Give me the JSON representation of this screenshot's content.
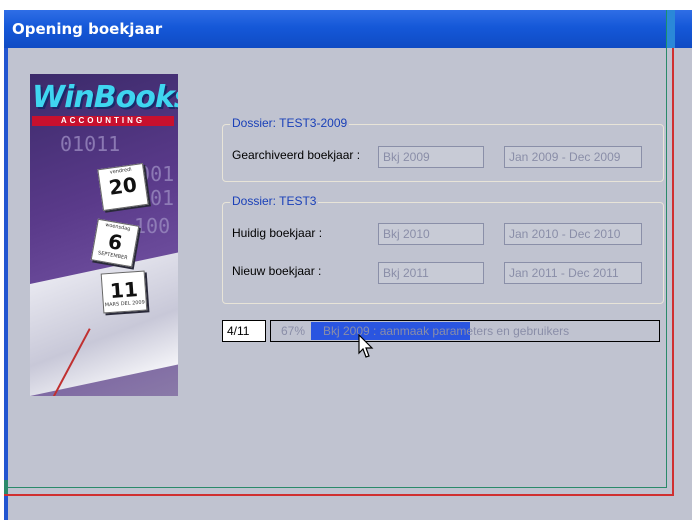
{
  "window": {
    "title": "Opening boekjaar"
  },
  "logo": {
    "brand": "WinBooks",
    "tagline": "ACCOUNTING",
    "binary": [
      "01011",
      "1001",
      "01",
      "100"
    ],
    "calendar": [
      {
        "head": "vendredi",
        "num": "20",
        "foot": ""
      },
      {
        "head": "woensdag",
        "num": "6",
        "foot": "SEPTEMBER"
      },
      {
        "head": "",
        "num": "11",
        "foot": "MARS DEL 2009"
      }
    ]
  },
  "group1": {
    "title": "Dossier: TEST3-2009",
    "rows": [
      {
        "label": "Gearchiveerd boekjaar :",
        "year": "Bkj 2009",
        "period": "Jan 2009 - Dec 2009"
      }
    ]
  },
  "group2": {
    "title": "Dossier: TEST3",
    "rows": [
      {
        "label": "Huidig boekjaar :",
        "year": "Bkj 2010",
        "period": "Jan 2010 - Dec 2010"
      },
      {
        "label": "Nieuw boekjaar :",
        "year": "Bkj 2011",
        "period": "Jan 2011 - Dec 2011"
      }
    ]
  },
  "progress": {
    "counter": "4/11",
    "percent_text": "67%",
    "percent_value": 67,
    "step_text": "Bkj 2009 : aanmaak parameters en gebruikers"
  },
  "colors": {
    "titlebar": "#1558d8",
    "window_bg": "#c0c3d0",
    "group_title": "#1a40b8",
    "progress_fill": "#2a55e0",
    "frame_red": "#d03030"
  }
}
